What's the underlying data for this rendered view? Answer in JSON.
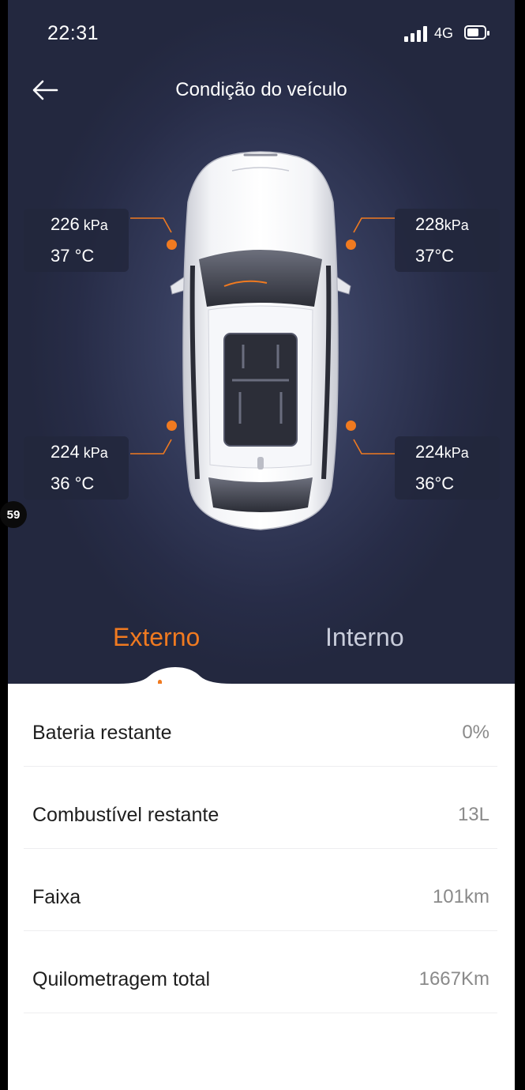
{
  "status_bar": {
    "time": "22:31",
    "network": "4G"
  },
  "header": {
    "title": "Condição do veículo"
  },
  "tires": {
    "front_left": {
      "pressure": "226",
      "pressure_unit": " kPa",
      "temperature": "37 °C"
    },
    "front_right": {
      "pressure": "228",
      "pressure_unit": "kPa",
      "temperature": "37°C"
    },
    "rear_left": {
      "pressure": "224",
      "pressure_unit": " kPa",
      "temperature": "36 °C"
    },
    "rear_right": {
      "pressure": "224",
      "pressure_unit": "kPa",
      "temperature": "36°C"
    }
  },
  "badge": "59",
  "tabs": [
    {
      "label": "Externo",
      "active": true
    },
    {
      "label": "Interno",
      "active": false
    }
  ],
  "details": [
    {
      "label": "Bateria restante",
      "value": "0%"
    },
    {
      "label": "Combustível restante",
      "value": "13L"
    },
    {
      "label": "Faixa",
      "value": "101km"
    },
    {
      "label": "Quilometragem total",
      "value": "1667Km"
    }
  ],
  "colors": {
    "accent": "#f07a20",
    "background": "#272c47"
  }
}
